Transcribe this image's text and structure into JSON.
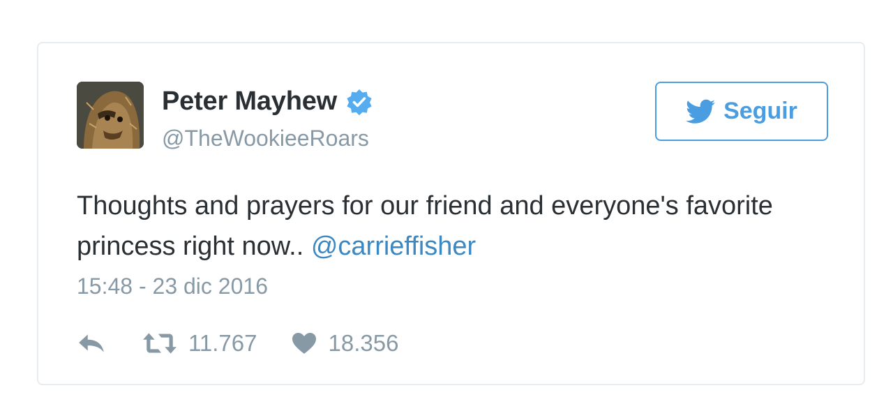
{
  "tweet": {
    "display_name": "Peter Mayhew",
    "handle": "@TheWookieeRoars",
    "verified": true,
    "avatar_icon": "chewbacca-avatar",
    "follow_button": {
      "label": "Seguir",
      "icon": "twitter-bird-icon"
    },
    "text_before_mention": "Thoughts and prayers for our friend and everyone's favorite princess right now..",
    "mention": "@carrieffisher",
    "timestamp": "15:48 - 23 dic 2016",
    "actions": {
      "reply_icon": "reply-icon",
      "retweet_icon": "retweet-icon",
      "retweet_count": "11.767",
      "like_icon": "heart-icon",
      "like_count": "18.356"
    }
  },
  "colors": {
    "text_primary": "#292f33",
    "text_secondary": "#8899a6",
    "link": "#3b88c3",
    "follow_accent": "#4a9de0",
    "verified": "#55acee",
    "card_border": "#e6ecf0"
  }
}
